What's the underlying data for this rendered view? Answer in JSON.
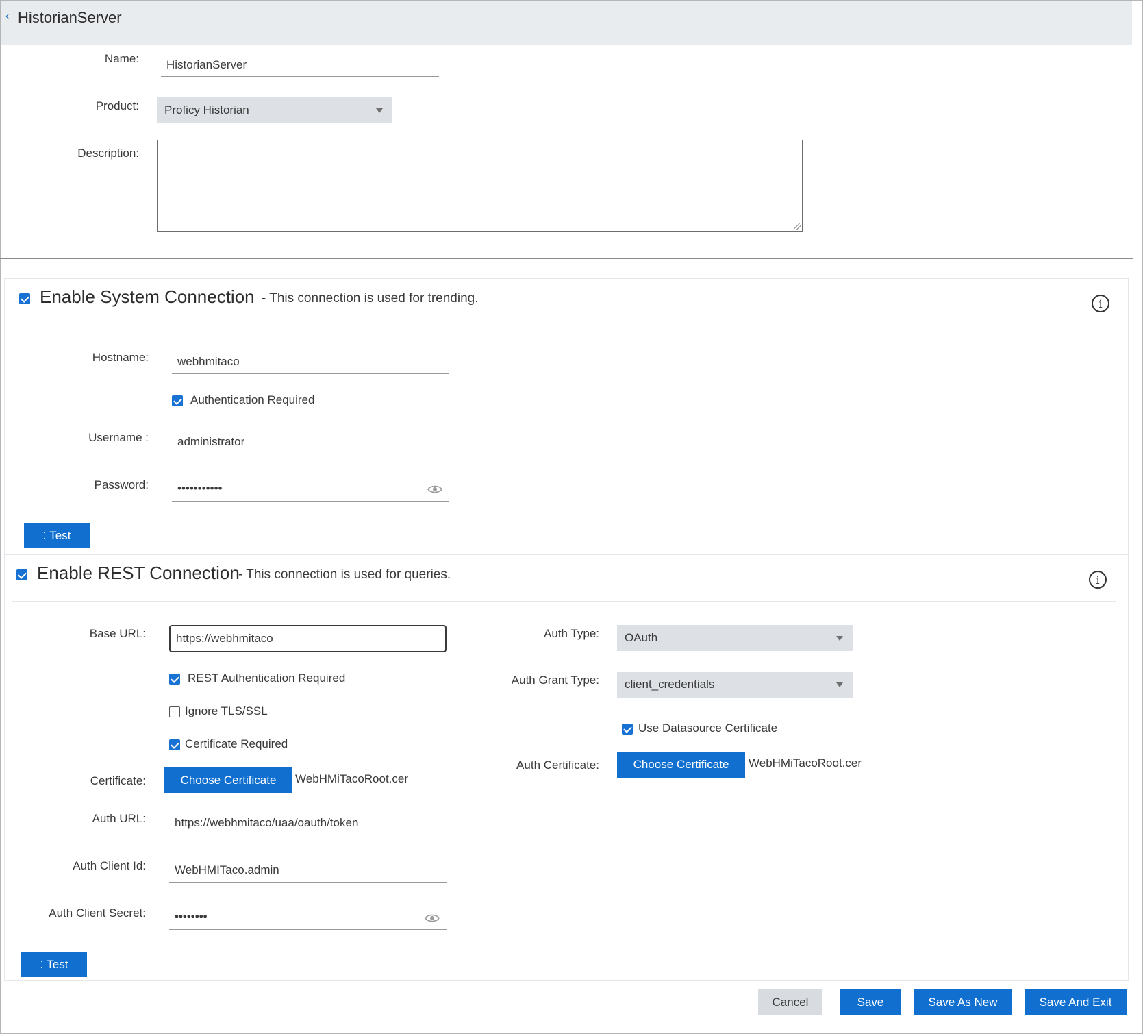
{
  "header": {
    "title": "HistorianServer",
    "back_icon": "chevron-left-icon"
  },
  "general": {
    "name_label": "Name:",
    "name_value": "HistorianServer",
    "product_label": "Product:",
    "product_value": "Proficy Historian",
    "description_label": "Description:",
    "description_value": ""
  },
  "system_connection": {
    "enabled": true,
    "title": "Enable System Connection",
    "subtitle": "- This connection is used for trending.",
    "hostname_label": "Hostname:",
    "hostname_value": "webhmitaco",
    "auth_required_label": "Authentication Required",
    "auth_required": true,
    "username_label": "Username :",
    "username_value": "administrator",
    "password_label": "Password:",
    "password_value": "•••••••••••",
    "test_label": "Test"
  },
  "rest_connection": {
    "enabled": true,
    "title": "Enable REST Connection",
    "subtitle": "- This connection is used for queries.",
    "base_url_label": "Base URL:",
    "base_url_value": "https://webhmitaco",
    "rest_auth_label": "REST Authentication Required",
    "rest_auth": true,
    "ignore_tls_label": "Ignore TLS/SSL",
    "ignore_tls": false,
    "cert_required_label": "Certificate Required",
    "cert_required": true,
    "certificate_label": "Certificate:",
    "choose_cert_label": "Choose Certificate",
    "certificate_file": "WebHMiTacoRoot.cer",
    "auth_url_label": "Auth URL:",
    "auth_url_value": "https://webhmitaco/uaa/oauth/token",
    "auth_client_id_label": "Auth Client Id:",
    "auth_client_id_value": "WebHMITaco.admin",
    "auth_client_secret_label": "Auth Client Secret:",
    "auth_client_secret_value": "••••••••",
    "auth_type_label": "Auth Type:",
    "auth_type_value": "OAuth",
    "auth_grant_type_label": "Auth Grant Type:",
    "auth_grant_type_value": "client_credentials",
    "use_ds_cert_label": "Use Datasource Certificate",
    "use_ds_cert": true,
    "auth_certificate_label": "Auth Certificate:",
    "auth_choose_cert_label": "Choose Certificate",
    "auth_certificate_file": "WebHMiTacoRoot.cer",
    "test_label": "Test"
  },
  "footer": {
    "cancel_label": "Cancel",
    "save_label": "Save",
    "save_as_new_label": "Save As New",
    "save_and_exit_label": "Save And Exit"
  },
  "colors": {
    "primary": "#1170cf",
    "header_bg": "#e9ecef",
    "select_bg": "#dde1e6"
  }
}
